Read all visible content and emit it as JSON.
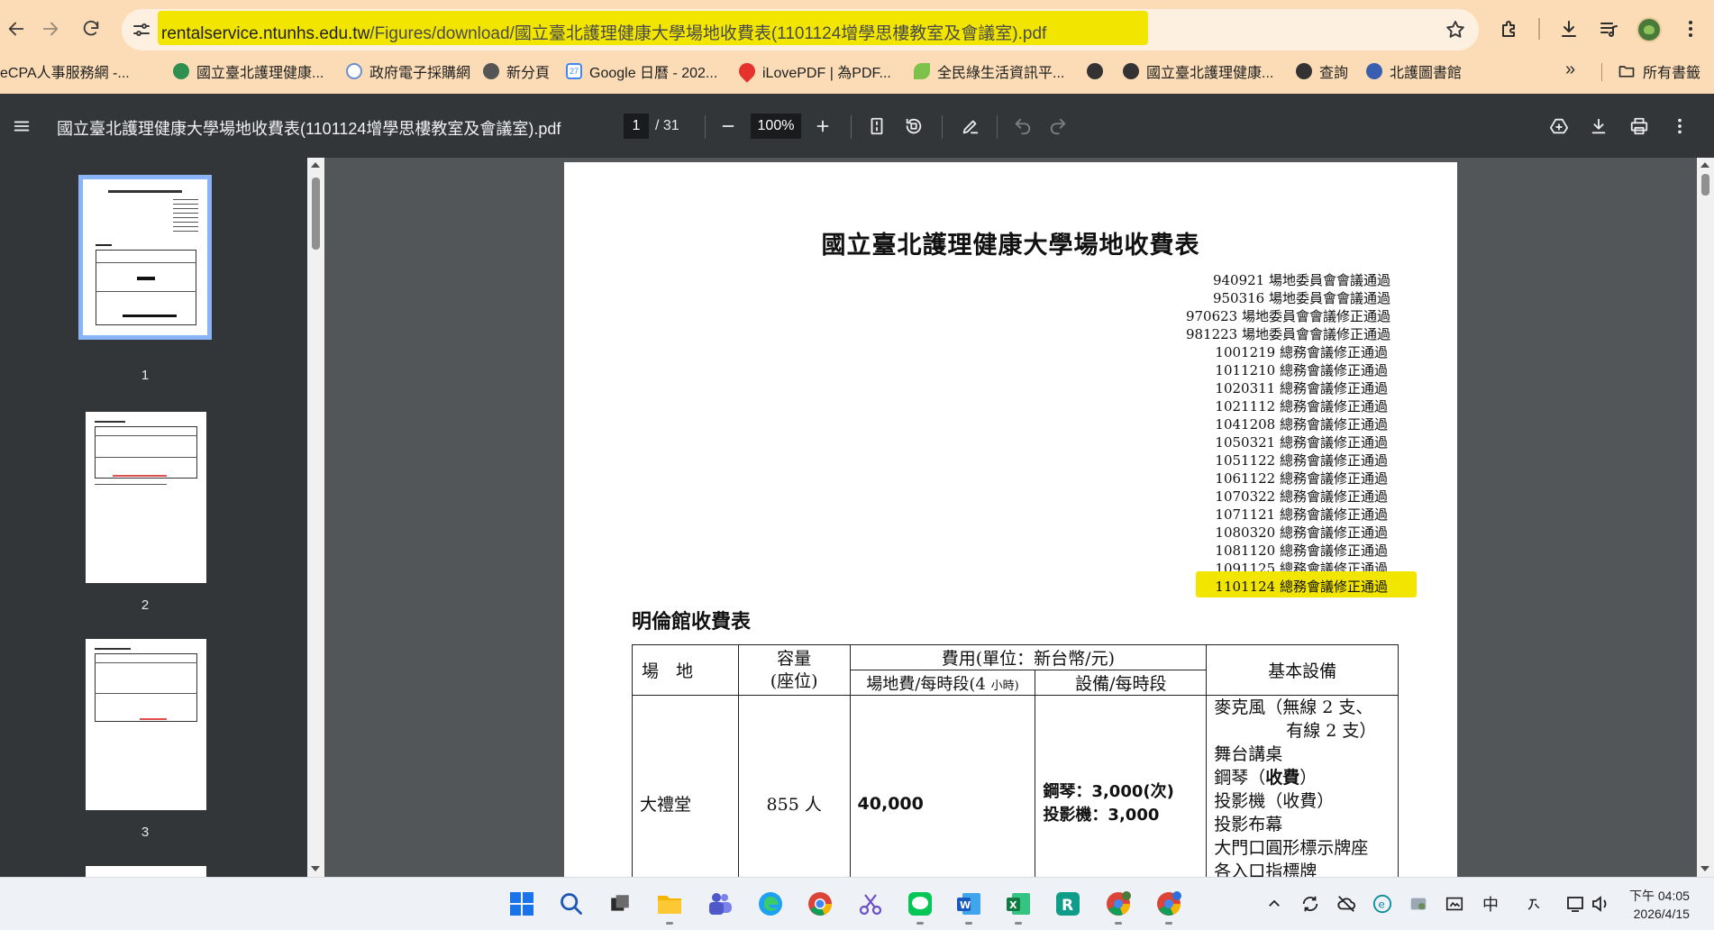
{
  "browser": {
    "url_host": "rentalservice.ntunhs.edu.tw",
    "url_path": "/Figures/download/國立臺北護理健康大學場地收費表(1101124增學思樓教室及會議室).pdf",
    "bookmarks": [
      {
        "label": "eCPA人事服務網 -..."
      },
      {
        "label": "國立臺北護理健康..."
      },
      {
        "label": "政府電子採購網"
      },
      {
        "label": "新分頁"
      },
      {
        "label": "Google 日曆 - 202..."
      },
      {
        "label": "iLovePDF | 為PDF..."
      },
      {
        "label": "全民綠生活資訊平..."
      },
      {
        "label": ""
      },
      {
        "label": "國立臺北護理健康..."
      },
      {
        "label": "查詢"
      },
      {
        "label": "北護圖書館"
      }
    ],
    "bookmarks_more": "»",
    "all_bookmarks": "所有書籤",
    "gcal_badge": "27"
  },
  "pdf_viewer": {
    "title": "國立臺北護理健康大學場地收費表(1101124增學思樓教室及會議室).pdf",
    "current_page": "1",
    "total_pages": "/ 31",
    "zoom": "100%",
    "thumbnails": [
      {
        "number": "1"
      },
      {
        "number": "2"
      },
      {
        "number": "3"
      }
    ]
  },
  "document": {
    "title": "國立臺北護理健康大學場地收費表",
    "revisions": [
      "940921 場地委員會會議通過",
      "950316 場地委員會會議通過",
      "970623 場地委員會會議修正通過",
      "981223 場地委員會會議修正通過",
      "1001219 總務會議修正通過",
      "1011210 總務會議修正通過",
      "1020311 總務會議修正通過",
      "1021112 總務會議修正通過",
      "1041208 總務會議修正通過",
      "1050321 總務會議修正通過",
      "1051122 總務會議修正通過",
      "1061122 總務會議修正通過",
      "1070322 總務會議修正通過",
      "1071121 總務會議修正通過",
      "1080320 總務會議修正通過",
      "1081120 總務會議修正通過",
      "1091125 總務會議修正通過",
      "1101124 總務會議修正通過"
    ],
    "section_title": "明倫館收費表",
    "table": {
      "col_venue": "場　地",
      "col_capacity_1": "容量",
      "col_capacity_2": "(座位)",
      "col_fee_group": "費用(單位：新台幣/元)",
      "col_fee_venue_a": "場地費/每時段(4",
      "col_fee_venue_b": "小時)",
      "col_fee_equipment": "設備/每時段",
      "col_equipment": "基本設備",
      "rows": [
        {
          "venue": "大禮堂",
          "capacity": "855 人",
          "fee": "40,000",
          "equipment_fee_1": "鋼琴：3,000(次)",
          "equipment_fee_2": "投影機：3,000",
          "equipment_1": "麥克風（無線 2 支、",
          "equipment_2": "有線 2 支）",
          "equipment_3": "舞台講桌",
          "equipment_4a": "鋼琴（",
          "equipment_4b": "收費",
          "equipment_4c": "）",
          "equipment_5": "投影機（收費）",
          "equipment_6": "投影布幕",
          "equipment_7": "大門口圓形標示牌座",
          "equipment_8": "各入口指標牌"
        }
      ]
    }
  },
  "taskbar": {
    "tray_ime": "中",
    "time": "下午 04:05",
    "date": "2026/4/15"
  },
  "colors": {
    "chrome_bg": "#fbdcb6",
    "highlight": "#f2e600",
    "pdf_toolbar": "#323639",
    "viewer_bg": "#525659"
  }
}
